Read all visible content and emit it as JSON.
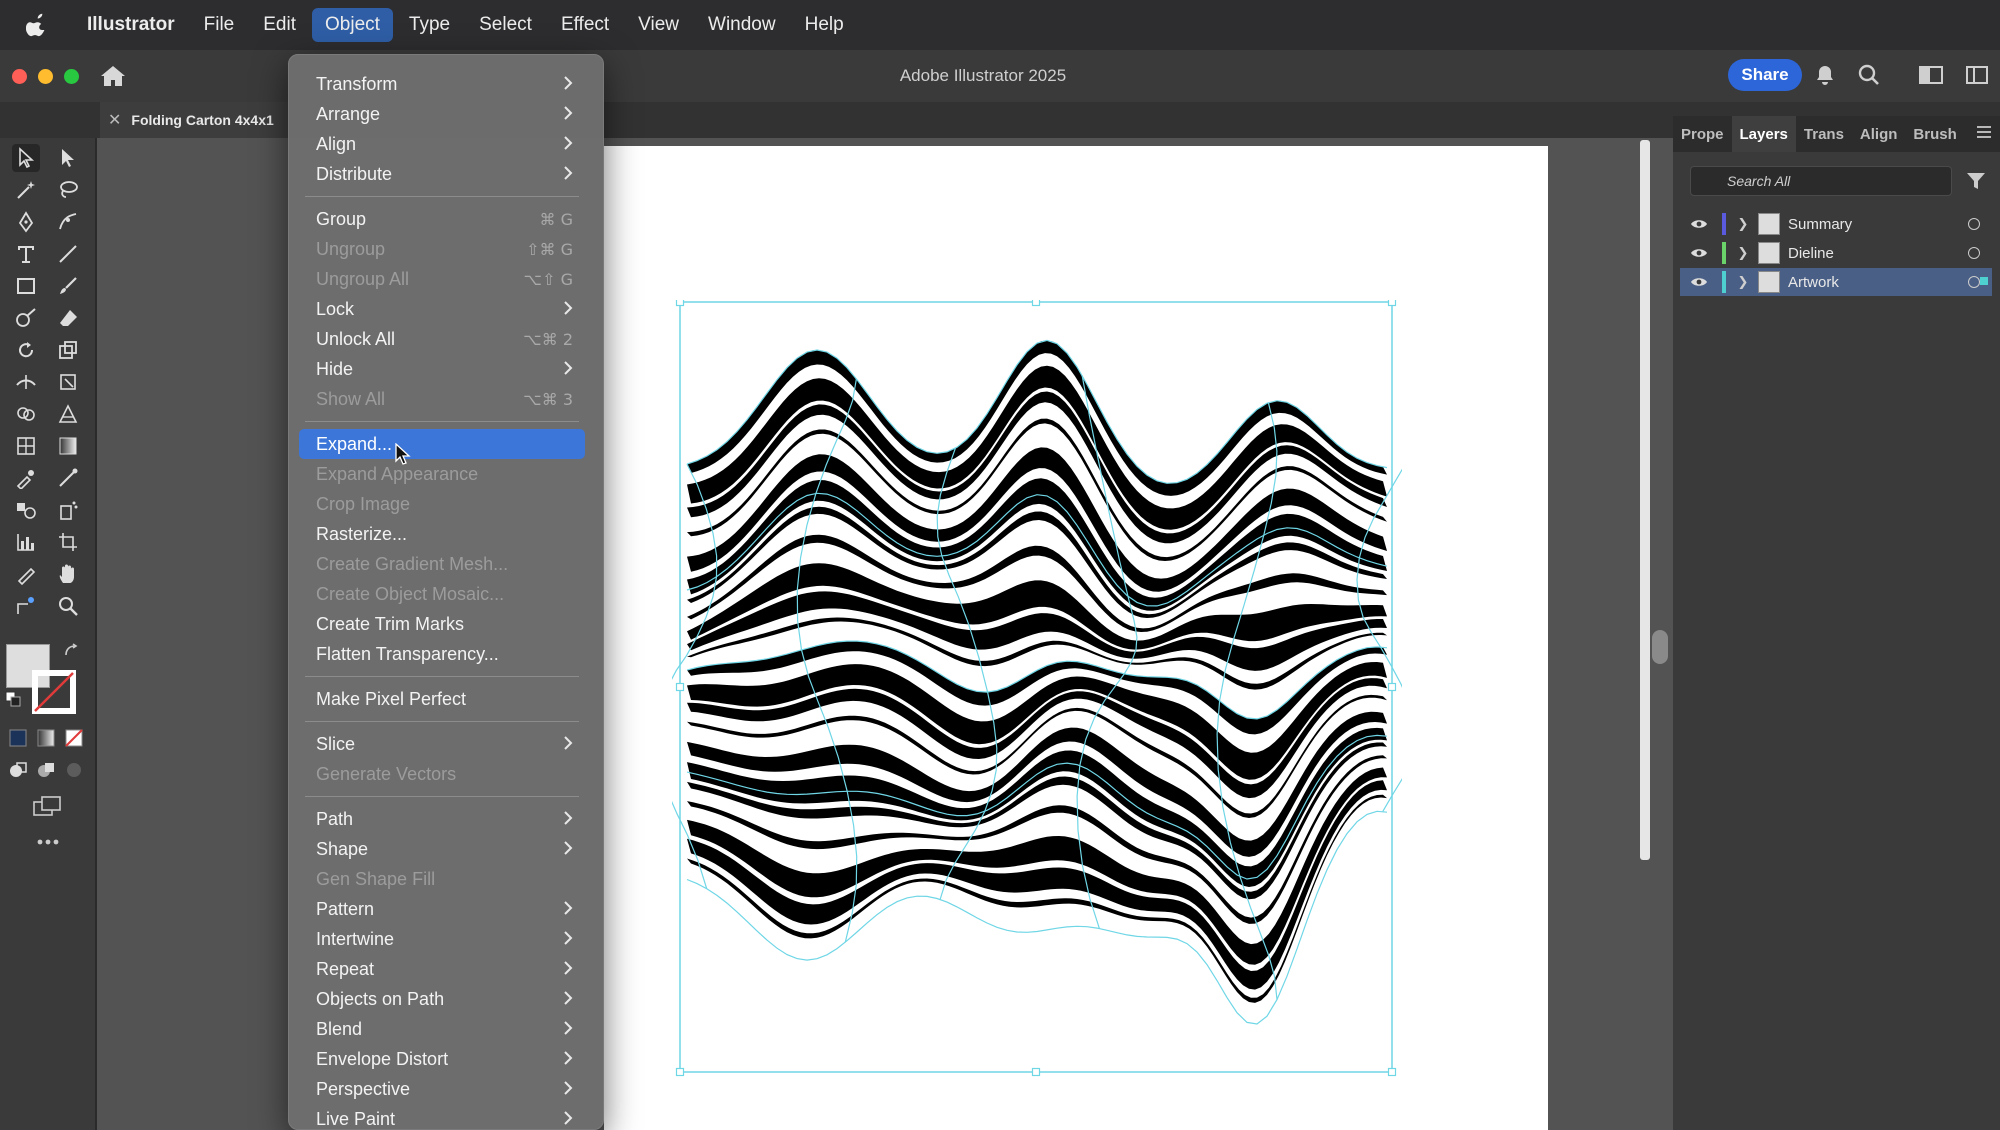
{
  "menubar": {
    "app": "Illustrator",
    "items": [
      "File",
      "Edit",
      "Object",
      "Type",
      "Select",
      "Effect",
      "View",
      "Window",
      "Help"
    ],
    "active": "Object"
  },
  "window": {
    "title": "Adobe Illustrator 2025",
    "share_label": "Share",
    "document_tab": "Folding Carton 4x4x1",
    "traffic_colors": {
      "close": "#ff5f57",
      "minimize": "#febc2e",
      "zoom": "#28c840"
    }
  },
  "object_menu": {
    "items": [
      {
        "label": "Transform",
        "shortcut": "",
        "submenu": true,
        "disabled": false
      },
      {
        "label": "Arrange",
        "shortcut": "",
        "submenu": true,
        "disabled": false
      },
      {
        "label": "Align",
        "shortcut": "",
        "submenu": true,
        "disabled": false
      },
      {
        "label": "Distribute",
        "shortcut": "",
        "submenu": true,
        "disabled": false
      },
      {
        "label": "Group",
        "shortcut": "⌘ G",
        "submenu": false,
        "disabled": false
      },
      {
        "label": "Ungroup",
        "shortcut": "⇧⌘ G",
        "submenu": false,
        "disabled": true
      },
      {
        "label": "Ungroup All",
        "shortcut": "⌥⇧ G",
        "submenu": false,
        "disabled": true
      },
      {
        "label": "Lock",
        "shortcut": "",
        "submenu": true,
        "disabled": false
      },
      {
        "label": "Unlock All",
        "shortcut": "⌥⌘ 2",
        "submenu": false,
        "disabled": false
      },
      {
        "label": "Hide",
        "shortcut": "",
        "submenu": true,
        "disabled": false
      },
      {
        "label": "Show All",
        "shortcut": "⌥⌘ 3",
        "submenu": false,
        "disabled": true
      },
      {
        "label": "Expand...",
        "shortcut": "",
        "submenu": false,
        "disabled": false,
        "highlighted": true
      },
      {
        "label": "Expand Appearance",
        "shortcut": "",
        "submenu": false,
        "disabled": true
      },
      {
        "label": "Crop Image",
        "shortcut": "",
        "submenu": false,
        "disabled": true
      },
      {
        "label": "Rasterize...",
        "shortcut": "",
        "submenu": false,
        "disabled": false
      },
      {
        "label": "Create Gradient Mesh...",
        "shortcut": "",
        "submenu": false,
        "disabled": true
      },
      {
        "label": "Create Object Mosaic...",
        "shortcut": "",
        "submenu": false,
        "disabled": true
      },
      {
        "label": "Create Trim Marks",
        "shortcut": "",
        "submenu": false,
        "disabled": false
      },
      {
        "label": "Flatten Transparency...",
        "shortcut": "",
        "submenu": false,
        "disabled": false
      },
      {
        "label": "Make Pixel Perfect",
        "shortcut": "",
        "submenu": false,
        "disabled": false
      },
      {
        "label": "Slice",
        "shortcut": "",
        "submenu": true,
        "disabled": false
      },
      {
        "label": "Generate Vectors",
        "shortcut": "",
        "submenu": false,
        "disabled": true
      },
      {
        "label": "Path",
        "shortcut": "",
        "submenu": true,
        "disabled": false
      },
      {
        "label": "Shape",
        "shortcut": "",
        "submenu": true,
        "disabled": false
      },
      {
        "label": "Gen Shape Fill",
        "shortcut": "",
        "submenu": false,
        "disabled": true
      },
      {
        "label": "Pattern",
        "shortcut": "",
        "submenu": true,
        "disabled": false
      },
      {
        "label": "Intertwine",
        "shortcut": "",
        "submenu": true,
        "disabled": false
      },
      {
        "label": "Repeat",
        "shortcut": "",
        "submenu": true,
        "disabled": false
      },
      {
        "label": "Objects on Path",
        "shortcut": "",
        "submenu": true,
        "disabled": false
      },
      {
        "label": "Blend",
        "shortcut": "",
        "submenu": true,
        "disabled": false
      },
      {
        "label": "Envelope Distort",
        "shortcut": "",
        "submenu": true,
        "disabled": false
      },
      {
        "label": "Perspective",
        "shortcut": "",
        "submenu": true,
        "disabled": false
      },
      {
        "label": "Live Paint",
        "shortcut": "",
        "submenu": true,
        "disabled": false
      }
    ]
  },
  "right_panel": {
    "tabs": [
      "Prope",
      "Layers",
      "Trans",
      "Align",
      "Brush"
    ],
    "active_tab": "Layers",
    "search_placeholder": "Search All",
    "layers": [
      {
        "name": "Summary",
        "color": "#5a5adf",
        "selected": false
      },
      {
        "name": "Dieline",
        "color": "#6ad46a",
        "selected": false
      },
      {
        "name": "Artwork",
        "color": "#4fd0d0",
        "selected": true
      }
    ]
  },
  "selection_color": "#6fd6e6"
}
